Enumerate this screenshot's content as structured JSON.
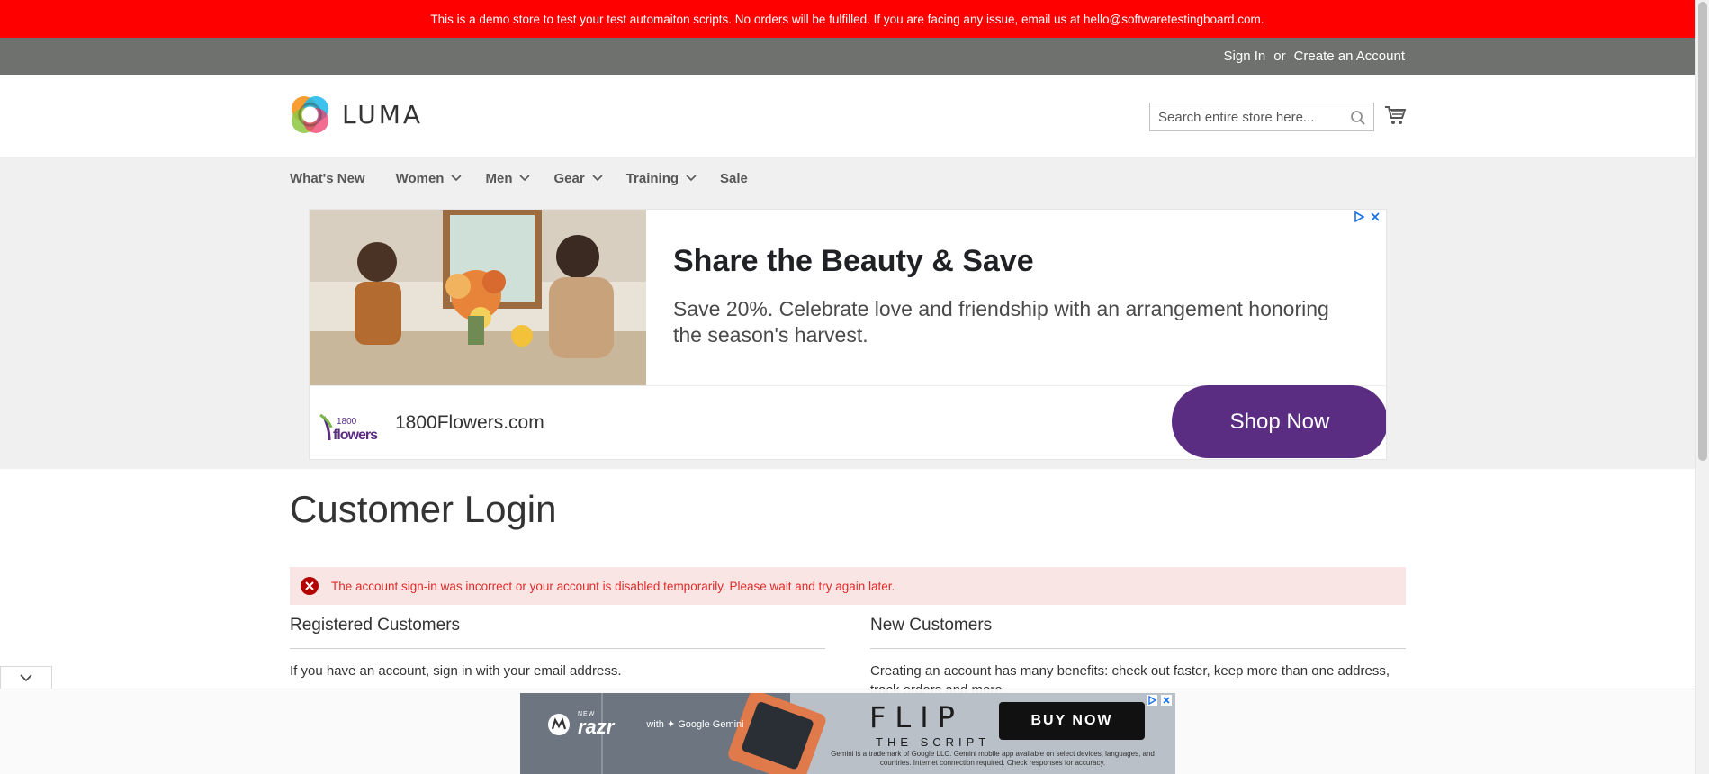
{
  "demo_notice": "This is a demo store to test your test automaiton scripts. No orders will be fulfilled. If you are facing any issue, email us at hello@softwaretestingboard.com.",
  "account": {
    "sign_in": "Sign In",
    "or": "or",
    "create_account": "Create an Account"
  },
  "header": {
    "logo_text": "LUMA",
    "search_placeholder": "Search entire store here..."
  },
  "nav": [
    {
      "label": "What's New"
    },
    {
      "label": "Women"
    },
    {
      "label": "Men"
    },
    {
      "label": "Gear"
    },
    {
      "label": "Training"
    },
    {
      "label": "Sale"
    }
  ],
  "ad_banner": {
    "title": "Share the Beauty & Save",
    "body": "Save 20%. Celebrate love and friendship with an arrangement honoring the season's harvest.",
    "brand": "1800Flowers.com",
    "brand_logo_top": "1800",
    "brand_logo_bottom": "flowers",
    "cta": "Shop Now"
  },
  "main": {
    "title": "Customer Login",
    "error": "The account sign-in was incorrect or your account is disabled temporarily. Please wait and try again later.",
    "registered_title": "Registered Customers",
    "registered_text": "If you have an account, sign in with your email address.",
    "new_title": "New Customers",
    "new_text": "Creating an account has many benefits: check out faster, keep more than one address, track orders and more."
  },
  "bottom_ad": {
    "new": "NEW",
    "brand": "razr",
    "partner": "with ✦ Google Gemini",
    "headline": "FLIP",
    "subline": "THE SCRIPT",
    "cta": "BUY NOW",
    "fine_print": "Gemini is a trademark of Google LLC. Gemini mobile app available on select devices, languages, and countries. Internet connection required. Check responses for accuracy."
  },
  "colors": {
    "notice_red": "#ff0000",
    "account_bar": "#6e716e",
    "cta_purple": "#5a2d82",
    "error_bg": "#fae5e5",
    "error_text": "#e02b27"
  }
}
